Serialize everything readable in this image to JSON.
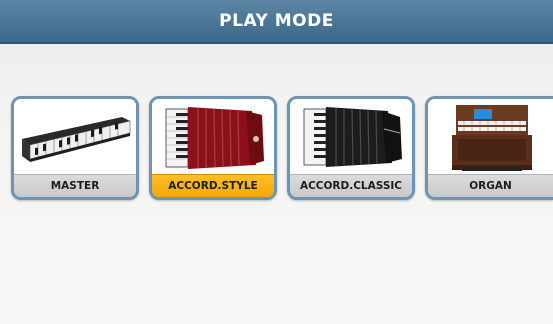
{
  "header": {
    "title": "PLAY MODE"
  },
  "modes": [
    {
      "label": "MASTER",
      "icon": "keyboard-icon",
      "selected": false
    },
    {
      "label": "ACCORD.STYLE",
      "icon": "red-accordion-icon",
      "selected": true
    },
    {
      "label": "ACCORD.CLASSIC",
      "icon": "black-accordion-icon",
      "selected": false
    },
    {
      "label": "ORGAN",
      "icon": "organ-icon",
      "selected": false
    }
  ],
  "colors": {
    "header": "#4a7596",
    "selected_label": "#f5a700",
    "tile_border": "#6f93b1"
  }
}
